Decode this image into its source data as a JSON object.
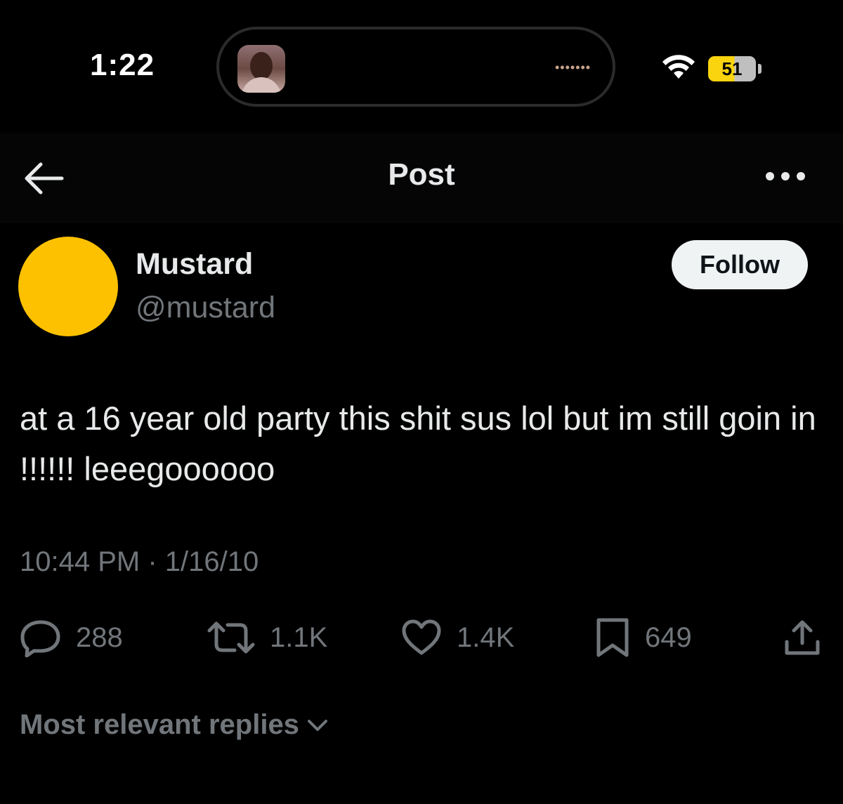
{
  "status_bar": {
    "time": "1:22",
    "battery": "51",
    "island_indicator": "•••••••",
    "icons": [
      "wifi-icon",
      "battery-icon"
    ]
  },
  "nav": {
    "title": "Post",
    "icons": [
      "back-arrow-icon",
      "more-icon"
    ]
  },
  "post": {
    "author": {
      "display_name": "Mustard",
      "handle": "@mustard",
      "avatar_color": "#fdc100"
    },
    "follow_label": "Follow",
    "text": "at a 16 year old party this shit sus lol but im still goin in !!!!!! leeegoooooo",
    "timestamp": "10:44 PM · 1/16/10",
    "stats": {
      "replies": "288",
      "reposts": "1.1K",
      "likes": "1.4K",
      "bookmarks": "649"
    },
    "stat_icons": [
      "reply-icon",
      "repost-icon",
      "like-icon",
      "bookmark-icon",
      "share-icon"
    ]
  },
  "replies_sort_label": "Most relevant replies",
  "colors": {
    "background": "#000000",
    "primary_text": "#e7e9ea",
    "secondary_text": "#71767b",
    "battery_yellow": "#f9d40f"
  }
}
